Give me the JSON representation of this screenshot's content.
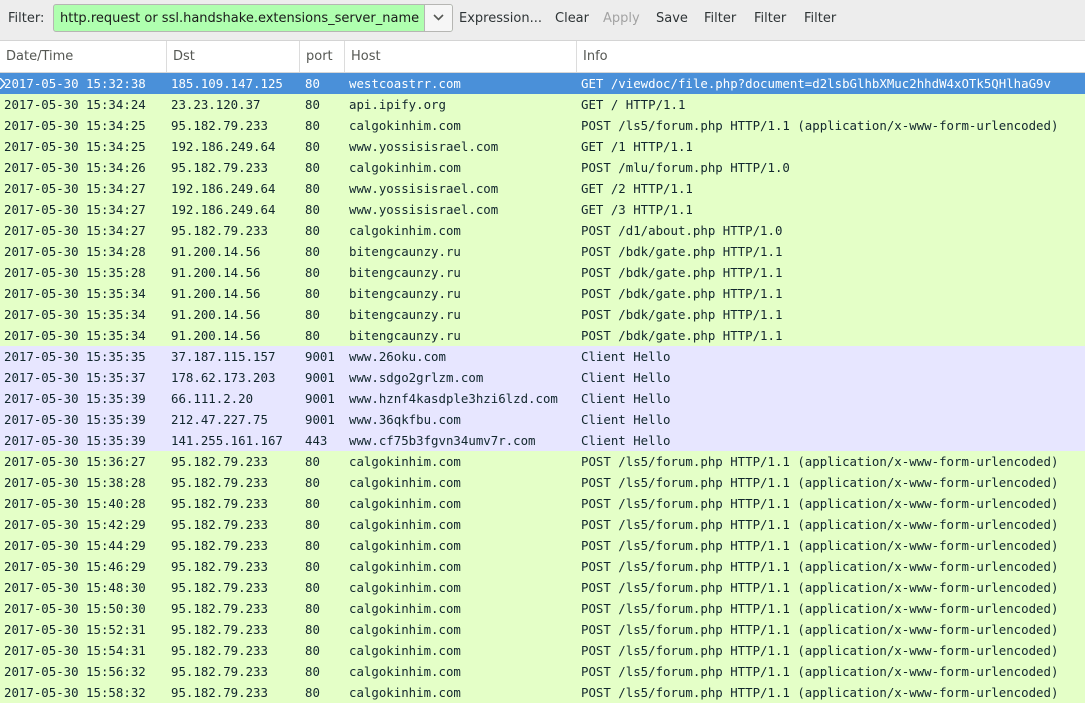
{
  "toolbar": {
    "filter_label": "Filter:",
    "filter_value": "http.request or ssl.handshake.extensions_server_name",
    "expression_label": "Expression...",
    "clear_label": "Clear",
    "apply_label": "Apply",
    "save_label": "Save",
    "filter_btn_1": "Filter",
    "filter_btn_2": "Filter",
    "filter_btn_3": "Filter"
  },
  "columns": {
    "date": "Date/Time",
    "dst": "Dst",
    "port": "port",
    "host": "Host",
    "info": "Info"
  },
  "colors": {
    "http_row": "#e4ffc7",
    "tls_row": "#e7e6ff",
    "selected_row": "#4a90d9",
    "filter_valid": "#afffaf"
  },
  "rows": [
    {
      "date": "2017-05-30 15:32:38",
      "dst": "185.109.147.125",
      "port": "80",
      "host": "westcoastrr.com",
      "info": "GET /viewdoc/file.php?document=d2lsbGlhbXMuc2hhdW4xOTk5QHlhaG9v",
      "kind": "http",
      "selected": true
    },
    {
      "date": "2017-05-30 15:34:24",
      "dst": "23.23.120.37",
      "port": "80",
      "host": "api.ipify.org",
      "info": "GET / HTTP/1.1",
      "kind": "http"
    },
    {
      "date": "2017-05-30 15:34:25",
      "dst": "95.182.79.233",
      "port": "80",
      "host": "calgokinhim.com",
      "info": "POST /ls5/forum.php HTTP/1.1  (application/x-www-form-urlencoded)",
      "kind": "http"
    },
    {
      "date": "2017-05-30 15:34:25",
      "dst": "192.186.249.64",
      "port": "80",
      "host": "www.yossisisrael.com",
      "info": "GET /1 HTTP/1.1",
      "kind": "http"
    },
    {
      "date": "2017-05-30 15:34:26",
      "dst": "95.182.79.233",
      "port": "80",
      "host": "calgokinhim.com",
      "info": "POST /mlu/forum.php HTTP/1.0",
      "kind": "http"
    },
    {
      "date": "2017-05-30 15:34:27",
      "dst": "192.186.249.64",
      "port": "80",
      "host": "www.yossisisrael.com",
      "info": "GET /2 HTTP/1.1",
      "kind": "http"
    },
    {
      "date": "2017-05-30 15:34:27",
      "dst": "192.186.249.64",
      "port": "80",
      "host": "www.yossisisrael.com",
      "info": "GET /3 HTTP/1.1",
      "kind": "http"
    },
    {
      "date": "2017-05-30 15:34:27",
      "dst": "95.182.79.233",
      "port": "80",
      "host": "calgokinhim.com",
      "info": "POST /d1/about.php HTTP/1.0",
      "kind": "http"
    },
    {
      "date": "2017-05-30 15:34:28",
      "dst": "91.200.14.56",
      "port": "80",
      "host": "bitengcaunzy.ru",
      "info": "POST /bdk/gate.php HTTP/1.1",
      "kind": "http"
    },
    {
      "date": "2017-05-30 15:35:28",
      "dst": "91.200.14.56",
      "port": "80",
      "host": "bitengcaunzy.ru",
      "info": "POST /bdk/gate.php HTTP/1.1",
      "kind": "http"
    },
    {
      "date": "2017-05-30 15:35:34",
      "dst": "91.200.14.56",
      "port": "80",
      "host": "bitengcaunzy.ru",
      "info": "POST /bdk/gate.php HTTP/1.1",
      "kind": "http"
    },
    {
      "date": "2017-05-30 15:35:34",
      "dst": "91.200.14.56",
      "port": "80",
      "host": "bitengcaunzy.ru",
      "info": "POST /bdk/gate.php HTTP/1.1",
      "kind": "http"
    },
    {
      "date": "2017-05-30 15:35:34",
      "dst": "91.200.14.56",
      "port": "80",
      "host": "bitengcaunzy.ru",
      "info": "POST /bdk/gate.php HTTP/1.1",
      "kind": "http"
    },
    {
      "date": "2017-05-30 15:35:35",
      "dst": "37.187.115.157",
      "port": "9001",
      "host": "www.26oku.com",
      "info": "Client Hello",
      "kind": "tls"
    },
    {
      "date": "2017-05-30 15:35:37",
      "dst": "178.62.173.203",
      "port": "9001",
      "host": "www.sdgo2grlzm.com",
      "info": "Client Hello",
      "kind": "tls"
    },
    {
      "date": "2017-05-30 15:35:39",
      "dst": "66.111.2.20",
      "port": "9001",
      "host": "www.hznf4kasdple3hzi6lzd.com",
      "info": "Client Hello",
      "kind": "tls"
    },
    {
      "date": "2017-05-30 15:35:39",
      "dst": "212.47.227.75",
      "port": "9001",
      "host": "www.36qkfbu.com",
      "info": "Client Hello",
      "kind": "tls"
    },
    {
      "date": "2017-05-30 15:35:39",
      "dst": "141.255.161.167",
      "port": "443",
      "host": "www.cf75b3fgvn34umv7r.com",
      "info": "Client Hello",
      "kind": "tls"
    },
    {
      "date": "2017-05-30 15:36:27",
      "dst": "95.182.79.233",
      "port": "80",
      "host": "calgokinhim.com",
      "info": "POST /ls5/forum.php HTTP/1.1  (application/x-www-form-urlencoded)",
      "kind": "http"
    },
    {
      "date": "2017-05-30 15:38:28",
      "dst": "95.182.79.233",
      "port": "80",
      "host": "calgokinhim.com",
      "info": "POST /ls5/forum.php HTTP/1.1  (application/x-www-form-urlencoded)",
      "kind": "http"
    },
    {
      "date": "2017-05-30 15:40:28",
      "dst": "95.182.79.233",
      "port": "80",
      "host": "calgokinhim.com",
      "info": "POST /ls5/forum.php HTTP/1.1  (application/x-www-form-urlencoded)",
      "kind": "http"
    },
    {
      "date": "2017-05-30 15:42:29",
      "dst": "95.182.79.233",
      "port": "80",
      "host": "calgokinhim.com",
      "info": "POST /ls5/forum.php HTTP/1.1  (application/x-www-form-urlencoded)",
      "kind": "http"
    },
    {
      "date": "2017-05-30 15:44:29",
      "dst": "95.182.79.233",
      "port": "80",
      "host": "calgokinhim.com",
      "info": "POST /ls5/forum.php HTTP/1.1  (application/x-www-form-urlencoded)",
      "kind": "http"
    },
    {
      "date": "2017-05-30 15:46:29",
      "dst": "95.182.79.233",
      "port": "80",
      "host": "calgokinhim.com",
      "info": "POST /ls5/forum.php HTTP/1.1  (application/x-www-form-urlencoded)",
      "kind": "http"
    },
    {
      "date": "2017-05-30 15:48:30",
      "dst": "95.182.79.233",
      "port": "80",
      "host": "calgokinhim.com",
      "info": "POST /ls5/forum.php HTTP/1.1  (application/x-www-form-urlencoded)",
      "kind": "http"
    },
    {
      "date": "2017-05-30 15:50:30",
      "dst": "95.182.79.233",
      "port": "80",
      "host": "calgokinhim.com",
      "info": "POST /ls5/forum.php HTTP/1.1  (application/x-www-form-urlencoded)",
      "kind": "http"
    },
    {
      "date": "2017-05-30 15:52:31",
      "dst": "95.182.79.233",
      "port": "80",
      "host": "calgokinhim.com",
      "info": "POST /ls5/forum.php HTTP/1.1  (application/x-www-form-urlencoded)",
      "kind": "http"
    },
    {
      "date": "2017-05-30 15:54:31",
      "dst": "95.182.79.233",
      "port": "80",
      "host": "calgokinhim.com",
      "info": "POST /ls5/forum.php HTTP/1.1  (application/x-www-form-urlencoded)",
      "kind": "http"
    },
    {
      "date": "2017-05-30 15:56:32",
      "dst": "95.182.79.233",
      "port": "80",
      "host": "calgokinhim.com",
      "info": "POST /ls5/forum.php HTTP/1.1  (application/x-www-form-urlencoded)",
      "kind": "http"
    },
    {
      "date": "2017-05-30 15:58:32",
      "dst": "95.182.79.233",
      "port": "80",
      "host": "calgokinhim.com",
      "info": "POST /ls5/forum.php HTTP/1.1  (application/x-www-form-urlencoded)",
      "kind": "http"
    }
  ]
}
